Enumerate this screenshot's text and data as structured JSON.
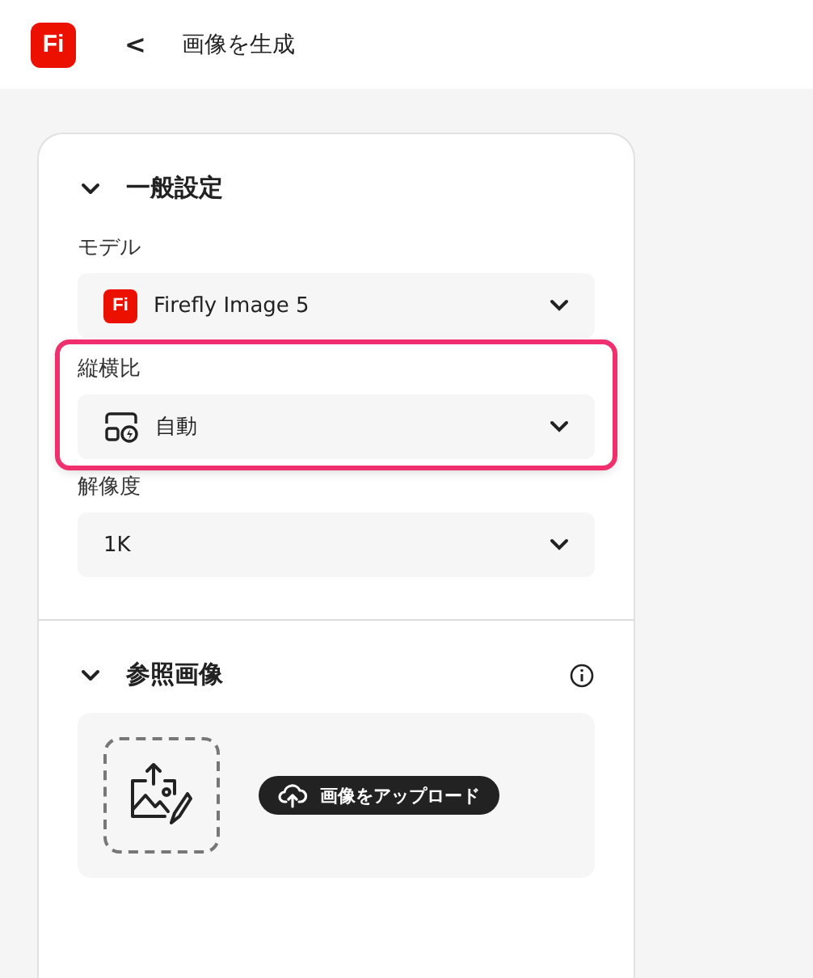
{
  "header": {
    "logo": "Fi",
    "back": "<",
    "title": "画像を生成"
  },
  "sections": [
    {
      "title": "一般設定",
      "expanded": true,
      "fields": [
        {
          "label": "モデル",
          "value": "Firefly Image 5",
          "kind": "model",
          "logo_text": "Fi",
          "highlighted": false
        },
        {
          "label": "縦横比",
          "value": "自動",
          "kind": "aspect",
          "highlighted": true
        },
        {
          "label": "解像度",
          "value": "1K",
          "kind": "plain",
          "highlighted": false
        }
      ]
    },
    {
      "title": "参照画像",
      "expanded": true,
      "info": true,
      "upload": {
        "button": "画像をアップロード"
      }
    }
  ]
}
